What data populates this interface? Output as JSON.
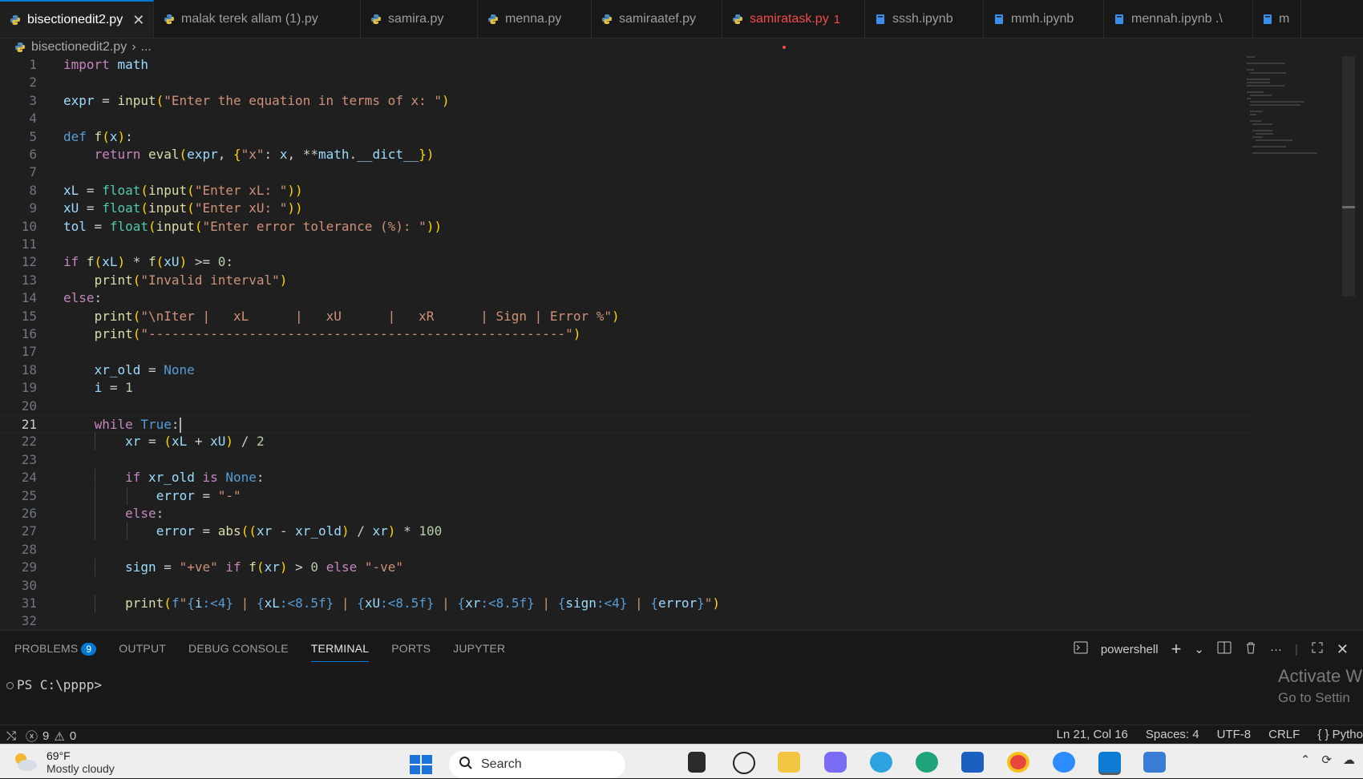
{
  "tabs": [
    {
      "label": "bisectionedit2.py",
      "active": true,
      "icon": "python-icon"
    },
    {
      "label": "malak terek allam (1).py",
      "icon": "python-icon"
    },
    {
      "label": "samira.py",
      "icon": "python-icon"
    },
    {
      "label": "menna.py",
      "icon": "python-icon"
    },
    {
      "label": "samiraatef.py",
      "icon": "python-icon"
    },
    {
      "label": "samiratask.py",
      "badge": "1",
      "modified": true,
      "icon": "python-icon"
    },
    {
      "label": "sssh.ipynb",
      "icon": "notebook-icon"
    },
    {
      "label": "mmh.ipynb",
      "icon": "notebook-icon"
    },
    {
      "label": "mennah.ipynb .\\",
      "icon": "notebook-icon"
    },
    {
      "label": "m",
      "icon": "notebook-icon"
    }
  ],
  "breadcrumb": {
    "file": "bisectionedit2.py",
    "more": "..."
  },
  "editor": {
    "current_line": 21,
    "lines": [
      "import math",
      "",
      "expr = input(\"Enter the equation in terms of x: \")",
      "",
      "def f(x):",
      "    return eval(expr, {\"x\": x, **math.__dict__})",
      "",
      "xL = float(input(\"Enter xL: \"))",
      "xU = float(input(\"Enter xU: \"))",
      "tol = float(input(\"Enter error tolerance (%): \"))",
      "",
      "if f(xL) * f(xU) >= 0:",
      "    print(\"Invalid interval\")",
      "else:",
      "    print(\"\\nIter |   xL      |   xU      |   xR      | Sign | Error %\")",
      "    print(\"------------------------------------------------------\")",
      "",
      "    xr_old = None",
      "    i = 1",
      "",
      "    while True:",
      "        xr = (xL + xU) / 2",
      "",
      "        if xr_old is None:",
      "            error = \"-\"",
      "        else:",
      "            error = abs((xr - xr_old) / xr) * 100",
      "",
      "        sign = \"+ve\" if f(xr) > 0 else \"-ve\"",
      "",
      "        print(f\"{i:<4} | {xL:<8.5f} | {xU:<8.5f} | {xr:<8.5f} | {sign:<4} | {error}\")",
      ""
    ]
  },
  "panel": {
    "tabs": [
      {
        "label": "PROBLEMS",
        "badge": "9"
      },
      {
        "label": "OUTPUT"
      },
      {
        "label": "DEBUG CONSOLE"
      },
      {
        "label": "TERMINAL",
        "active": true
      },
      {
        "label": "PORTS"
      },
      {
        "label": "JUPYTER"
      }
    ],
    "shell": "powershell",
    "prompt": "PS C:\\pppp>",
    "activate_line1": "Activate W",
    "activate_line2": "Go to Settin"
  },
  "status": {
    "errors": "9",
    "warnings": "0",
    "position": "Ln 21, Col 16",
    "spaces": "Spaces: 4",
    "encoding": "UTF-8",
    "eol": "CRLF",
    "language": "{ } Pytho"
  },
  "taskbar": {
    "temperature": "69°F",
    "weather": "Mostly cloudy",
    "search_label": "Search"
  },
  "colors": {
    "accent": "#0078d4",
    "error": "#f14c4c",
    "background": "#1f1f1f"
  }
}
